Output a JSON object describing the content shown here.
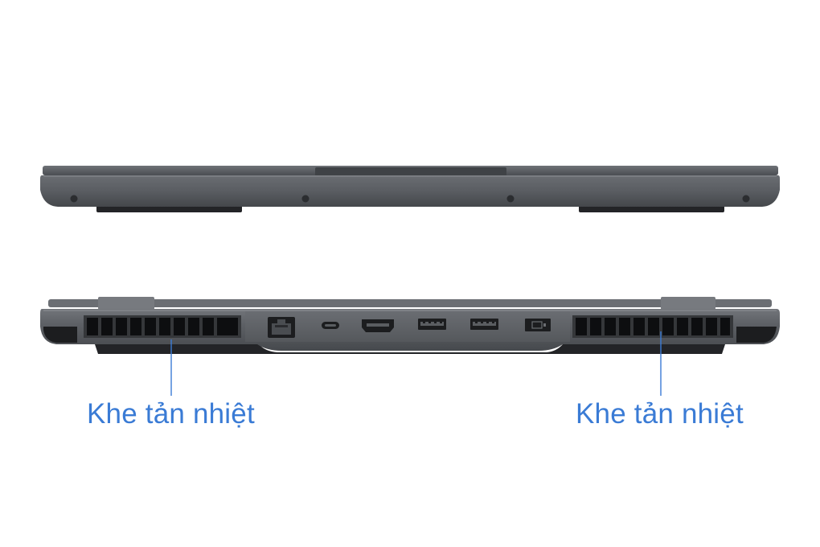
{
  "callouts": [
    {
      "label": "Khe tản nhiệt"
    },
    {
      "label": "Khe tản nhiệt"
    }
  ],
  "colors": {
    "label": "#3a7bd5",
    "leader_line": "#3a7bd5",
    "chassis": "#5b5e63",
    "chassis_dark": "#3a3c40",
    "vent": "#111214",
    "background": "#ffffff"
  },
  "ports": [
    {
      "icon": "ethernet-port-icon"
    },
    {
      "icon": "usb-c-port-icon"
    },
    {
      "icon": "hdmi-port-icon"
    },
    {
      "icon": "usb-a-port-icon"
    },
    {
      "icon": "usb-a-port-icon"
    },
    {
      "icon": "power-port-icon"
    }
  ]
}
